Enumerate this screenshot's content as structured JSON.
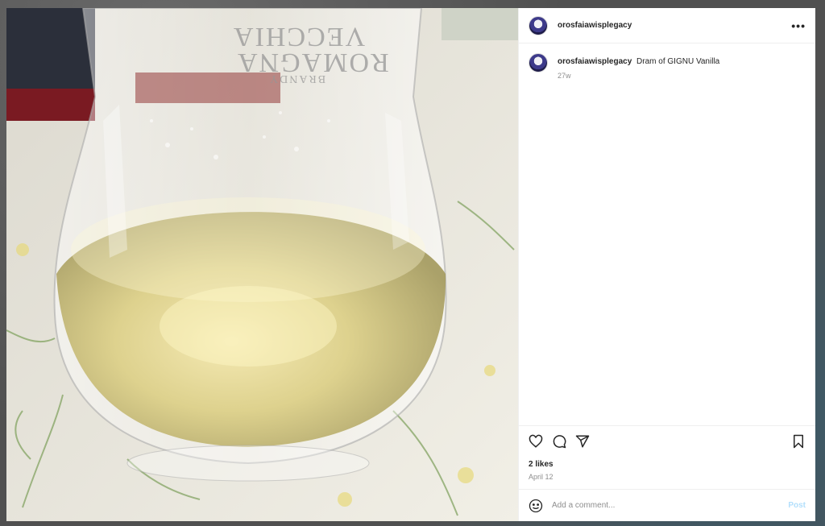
{
  "post": {
    "username": "orosfaiawisplegacy",
    "caption_username": "orosfaiawisplegacy",
    "caption": "Dram of GIGNU Vanilla",
    "caption_age": "27w",
    "likes": "2 likes",
    "date": "April 12"
  },
  "photo": {
    "glass_etching": [
      "VECCHIA",
      "ROMAGNA",
      "BRANDY"
    ]
  },
  "comment_box": {
    "placeholder": "Add a comment...",
    "post_label": "Post"
  },
  "icons": {
    "more": "more-options-icon",
    "like": "heart-icon",
    "comment": "comment-bubble-icon",
    "share": "paper-plane-icon",
    "save": "bookmark-icon",
    "emoji": "smiley-icon"
  },
  "colors": {
    "post_button_disabled": "#b2dffc",
    "muted_text": "#8e8e8e",
    "primary_text": "#262626"
  }
}
